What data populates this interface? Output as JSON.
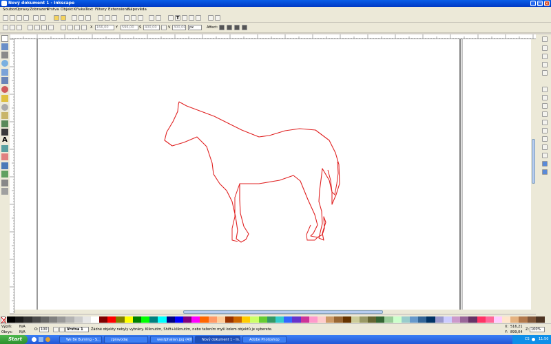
{
  "window": {
    "title": "Nový dokument 1 - Inkscape",
    "controls": [
      "_",
      "□",
      "×"
    ]
  },
  "menu": [
    "Soubor",
    "Úpravy",
    "Zobrazení",
    "Vrstva",
    "Objekt",
    "Křivka",
    "Text",
    "Filtery",
    "Extensions",
    "Nápověda"
  ],
  "toolbar_controls": {
    "x_label": "X",
    "x_value": "166,00",
    "y_label": "Y",
    "y_value": "596,00",
    "w_label": "Š",
    "w_value": "400,00",
    "h_label": "V",
    "h_value": "300,00",
    "unit": "px",
    "affect_label": "Affect:"
  },
  "status": {
    "fill_label": "Výplň:",
    "fill_value": "N/A",
    "stroke_label": "Obrys:",
    "stroke_value": "N/A",
    "opacity_label": "O:",
    "opacity_value": "100",
    "layer": "Vrstva 1",
    "message": "Žádné objekty nebyly vybrány. Kliknutím, Shift+kliknutím, nebo tažením myší kolem objektů je vyberete.",
    "x_label": "X:",
    "x_value": "516,21",
    "y_label": "Y:",
    "y_value": "899,04",
    "zoom_label": "Z:",
    "zoom_value": "100%"
  },
  "taskbar": {
    "start": "Start",
    "tasks": [
      "We Be Burning - S...",
      "zpravodaj",
      "westphalian.jpg (400...",
      "Nový dokument 1 - In...",
      "Adobe Photoshop"
    ],
    "active_index": 3,
    "lang": "CS",
    "clock": "11:50"
  },
  "colors": {
    "drawing_stroke": "#e02020",
    "page_border": "#000000",
    "title_bar": "#0039c4",
    "taskbar": "#2457d6"
  },
  "palette": [
    "#000000",
    "#1a1a1a",
    "#333333",
    "#4d4d4d",
    "#666666",
    "#808080",
    "#999999",
    "#b3b3b3",
    "#cccccc",
    "#e6e6e6",
    "#ffffff",
    "#800000",
    "#ff0000",
    "#808000",
    "#ffff00",
    "#008000",
    "#00ff00",
    "#008080",
    "#00ffff",
    "#000080",
    "#0000ff",
    "#800080",
    "#ff00ff",
    "#ff6600",
    "#ff9966",
    "#ffcc99",
    "#993300",
    "#cc6600",
    "#ffcc00",
    "#ccff66",
    "#66cc33",
    "#339966",
    "#33cccc",
    "#3366ff",
    "#6633cc",
    "#cc3399",
    "#ff99cc",
    "#ffcccc",
    "#cc9966",
    "#996633",
    "#663300",
    "#cccc99",
    "#999966",
    "#666633",
    "#336633",
    "#99cc99",
    "#ccffcc",
    "#99cccc",
    "#6699cc",
    "#336699",
    "#003366",
    "#9999cc",
    "#ccccff",
    "#cc99cc",
    "#996699",
    "#663366",
    "#ff3366",
    "#ff6699",
    "#ffccff",
    "#ffe5cc",
    "#e5b280",
    "#b37a4d",
    "#80573a",
    "#4d3423"
  ]
}
